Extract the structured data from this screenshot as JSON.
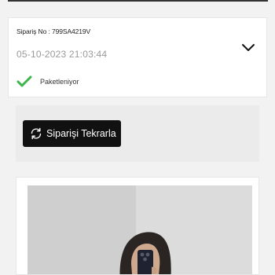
{
  "order": {
    "number_label": "Sipariş No : 799SA4219V",
    "date": "05-10-2023 21:03:44",
    "status": "Paketleniyor"
  },
  "actions": {
    "reorder_label": "Siparişi Tekrarla"
  },
  "colors": {
    "status_check": "#3cb54a",
    "button_bg": "#111111"
  },
  "icons": {
    "expand": "chevron-down-icon",
    "status": "check-icon",
    "reorder": "refresh-icon"
  }
}
